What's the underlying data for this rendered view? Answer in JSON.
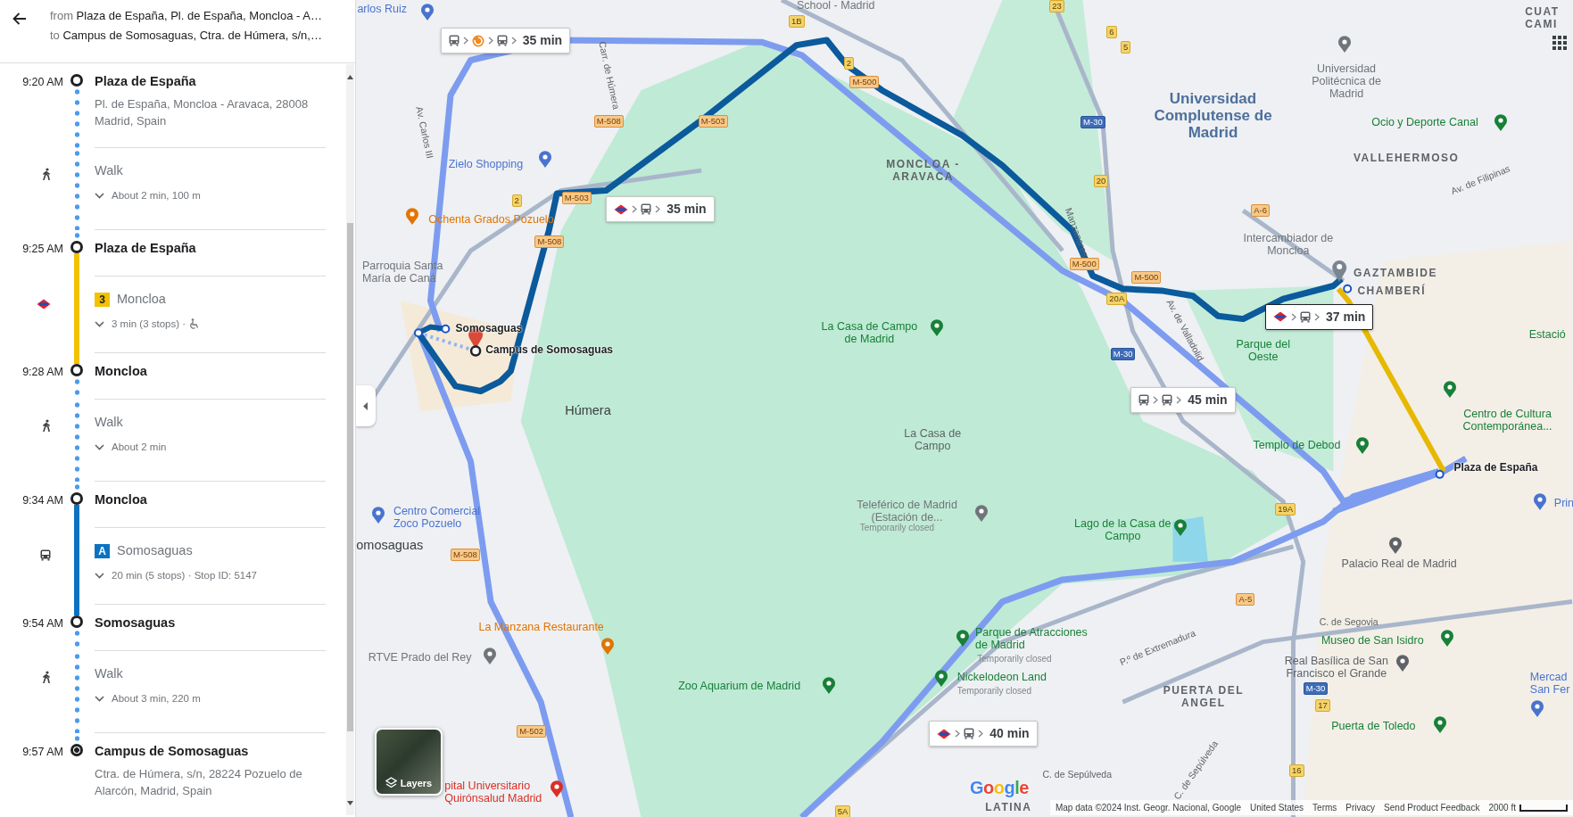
{
  "directions_panel": {
    "from_label": "from",
    "from": "Plaza de España, Pl. de España, Moncloa - A…",
    "to_label": "to",
    "to": "Campus de Somosaguas, Ctra. de Húmera, s/n,…",
    "steps": [
      {
        "kind": "stop",
        "time": "9:20 AM",
        "name": "Plaza de España",
        "address": "Pl. de España, Moncloa - Aravaca, 28008 Madrid, Spain",
        "destination": false
      },
      {
        "kind": "walk",
        "mode": "Walk",
        "detail": "About 2 min, 100 m"
      },
      {
        "kind": "stop",
        "time": "9:25 AM",
        "name": "Plaza de España",
        "destination": false
      },
      {
        "kind": "metro",
        "line": "3",
        "color": "#f2c200",
        "headsign": "Moncloa",
        "detail": "3 min (3 stops) ·",
        "wheelchair": true
      },
      {
        "kind": "stop",
        "time": "9:28 AM",
        "name": "Moncloa",
        "destination": false
      },
      {
        "kind": "walk",
        "mode": "Walk",
        "detail": "About 2 min"
      },
      {
        "kind": "stop",
        "time": "9:34 AM",
        "name": "Moncloa",
        "destination": false
      },
      {
        "kind": "bus",
        "line": "A",
        "color": "#0b72c2",
        "headsign": "Somosaguas",
        "detail": "20 min (5 stops) · Stop ID: 5147",
        "wheelchair": false
      },
      {
        "kind": "stop",
        "time": "9:54 AM",
        "name": "Somosaguas",
        "destination": false
      },
      {
        "kind": "walk",
        "mode": "Walk",
        "detail": "About 3 min, 220 m"
      },
      {
        "kind": "stop",
        "time": "9:57 AM",
        "name": "Campus de Somosaguas",
        "address": "Ctra. de Húmera, s/n, 28224 Pozuelo de Alarcón, Madrid, Spain",
        "destination": true
      }
    ]
  },
  "map": {
    "route_options": [
      {
        "modes": [
          {
            "kind": "bus"
          },
          {
            "kind": "rail"
          },
          {
            "kind": "bus"
          }
        ],
        "duration": "35 min",
        "selected": false
      },
      {
        "modes": [
          {
            "kind": "metro"
          },
          {
            "kind": "bus"
          }
        ],
        "duration": "35 min",
        "selected": false
      },
      {
        "modes": [
          {
            "kind": "metro"
          },
          {
            "kind": "bus"
          }
        ],
        "duration": "37 min",
        "selected": true
      },
      {
        "modes": [
          {
            "kind": "bus"
          },
          {
            "kind": "bus"
          }
        ],
        "duration": "45 min",
        "selected": false
      },
      {
        "modes": [
          {
            "kind": "metro"
          },
          {
            "kind": "bus"
          }
        ],
        "duration": "40 min",
        "selected": false
      }
    ],
    "labels": [
      {
        "text": "arlos Ruiz",
        "kind": "poi",
        "color": "#4a73d0"
      },
      {
        "text": "School - Madrid",
        "kind": "poi",
        "color": "#70757a"
      },
      {
        "text": "Zielo Shopping",
        "kind": "poi",
        "color": "#4a73d0"
      },
      {
        "text": "Ochenta Grados Pozuelo",
        "kind": "poi",
        "color": "#e37400"
      },
      {
        "text": "Parroquia Santa María de Caná",
        "kind": "poi",
        "color": "#70757a"
      },
      {
        "text": "Somosaguas",
        "kind": "stop"
      },
      {
        "text": "Campus de Somosaguas",
        "kind": "stop"
      },
      {
        "text": "MONCLOA - ARAVACA",
        "kind": "area"
      },
      {
        "text": "La Casa de Campo de Madrid",
        "kind": "poi",
        "color": "#188038"
      },
      {
        "text": "Húmera",
        "kind": "place"
      },
      {
        "text": "La Casa de Campo",
        "kind": "poi",
        "color": "#5f6368"
      },
      {
        "text": "Teleférico de Madrid (Estación de...",
        "kind": "poi",
        "color": "#70757a"
      },
      {
        "text": "Temporarily closed",
        "kind": "note"
      },
      {
        "text": "Lago de la Casa de Campo",
        "kind": "poi",
        "color": "#188038"
      },
      {
        "text": "Centro Comercial Zoco Pozuelo",
        "kind": "poi",
        "color": "#4a73d0"
      },
      {
        "text": "omosaguas",
        "kind": "place"
      },
      {
        "text": "La Manzana Restaurante",
        "kind": "poi",
        "color": "#e37400"
      },
      {
        "text": "RTVE Prado del Rey",
        "kind": "poi",
        "color": "#70757a"
      },
      {
        "text": "Zoo Aquarium de Madrid",
        "kind": "poi",
        "color": "#188038"
      },
      {
        "text": "Parque de Atracciones de Madrid",
        "kind": "poi",
        "color": "#188038"
      },
      {
        "text": "Temporarily closed",
        "kind": "note"
      },
      {
        "text": "Nickelodeon Land",
        "kind": "poi",
        "color": "#188038"
      },
      {
        "text": "Temporarily closed",
        "kind": "note"
      },
      {
        "text": "pital Universitario Quirónsalud Madrid",
        "kind": "poi",
        "color": "#d93025"
      },
      {
        "text": "Universidad Complutense de Madrid",
        "kind": "landmark"
      },
      {
        "text": "Universidad Politécnica de Madrid",
        "kind": "poi",
        "color": "#70757a"
      },
      {
        "text": "Ocio y Deporte Canal",
        "kind": "poi",
        "color": "#188038"
      },
      {
        "text": "VALLEHERMOSO",
        "kind": "area"
      },
      {
        "text": "Intercambiador de Moncloa",
        "kind": "poi",
        "color": "#70757a"
      },
      {
        "text": "GAZTAMBIDE",
        "kind": "area"
      },
      {
        "text": "CHAMBERÍ",
        "kind": "area"
      },
      {
        "text": "Parque del Oeste",
        "kind": "poi",
        "color": "#188038"
      },
      {
        "text": "Estació",
        "kind": "poi",
        "color": "#188038"
      },
      {
        "text": "Centro de Cultura Contemporánea...",
        "kind": "poi",
        "color": "#188038"
      },
      {
        "text": "Templo de Debod",
        "kind": "poi",
        "color": "#188038"
      },
      {
        "text": "Plaza de España",
        "kind": "stop"
      },
      {
        "text": "Prin",
        "kind": "poi",
        "color": "#4a73d0"
      },
      {
        "text": "Palacio Real de Madrid",
        "kind": "poi",
        "color": "#5f6368"
      },
      {
        "text": "C. de Segovia",
        "kind": "street"
      },
      {
        "text": "Museo de San Isidro",
        "kind": "poi",
        "color": "#188038"
      },
      {
        "text": "Real Basílica de San Francisco el Grande",
        "kind": "poi",
        "color": "#5f6368"
      },
      {
        "text": "Mercad San Fer",
        "kind": "poi",
        "color": "#4a73d0"
      },
      {
        "text": "Puerta de Toledo",
        "kind": "poi",
        "color": "#188038"
      },
      {
        "text": "PUERTA DEL ANGEL",
        "kind": "area"
      },
      {
        "text": "LATINA",
        "kind": "area"
      },
      {
        "text": "CUAT CAMI",
        "kind": "area"
      },
      {
        "text": "Av. Carlos III",
        "kind": "street"
      },
      {
        "text": "Carr. de Húmera",
        "kind": "street"
      },
      {
        "text": "Manzanares",
        "kind": "street"
      },
      {
        "text": "Av. de Valladolid",
        "kind": "street"
      },
      {
        "text": "Av. de Filipinas",
        "kind": "street"
      },
      {
        "text": "P.º de Extremadura",
        "kind": "street"
      },
      {
        "text": "C. de Sepúlveda",
        "kind": "street"
      },
      {
        "text": "C. de Sepúlveda",
        "kind": "street"
      }
    ],
    "road_shields": [
      {
        "label": "M-508",
        "kind": "regional"
      },
      {
        "label": "M-503",
        "kind": "regional"
      },
      {
        "label": "2",
        "kind": "exit"
      },
      {
        "label": "M-500",
        "kind": "regional"
      },
      {
        "label": "1B",
        "kind": "exit"
      },
      {
        "label": "M-503",
        "kind": "regional"
      },
      {
        "label": "2",
        "kind": "exit"
      },
      {
        "label": "M-508",
        "kind": "regional"
      },
      {
        "label": "M-30",
        "kind": "motorway"
      },
      {
        "label": "20",
        "kind": "exit"
      },
      {
        "label": "23",
        "kind": "exit"
      },
      {
        "label": "6",
        "kind": "exit"
      },
      {
        "label": "5",
        "kind": "exit"
      },
      {
        "label": "A-6",
        "kind": "regional"
      },
      {
        "label": "M-500",
        "kind": "regional"
      },
      {
        "label": "M-500",
        "kind": "regional"
      },
      {
        "label": "20A",
        "kind": "exit"
      },
      {
        "label": "M-30",
        "kind": "motorway"
      },
      {
        "label": "19A",
        "kind": "exit"
      },
      {
        "label": "A-5",
        "kind": "regional"
      },
      {
        "label": "M-30",
        "kind": "motorway"
      },
      {
        "label": "17",
        "kind": "exit"
      },
      {
        "label": "16",
        "kind": "exit"
      },
      {
        "label": "M-508",
        "kind": "regional"
      },
      {
        "label": "M-502",
        "kind": "regional"
      },
      {
        "label": "5A",
        "kind": "exit"
      }
    ],
    "layers_button": "Layers",
    "logo": "Google",
    "footer": [
      "Map data ©2024 Inst. Geogr. Nacional, Google",
      "United States",
      "Terms",
      "Privacy",
      "Send Product Feedback"
    ],
    "scale": "2000 ft"
  }
}
